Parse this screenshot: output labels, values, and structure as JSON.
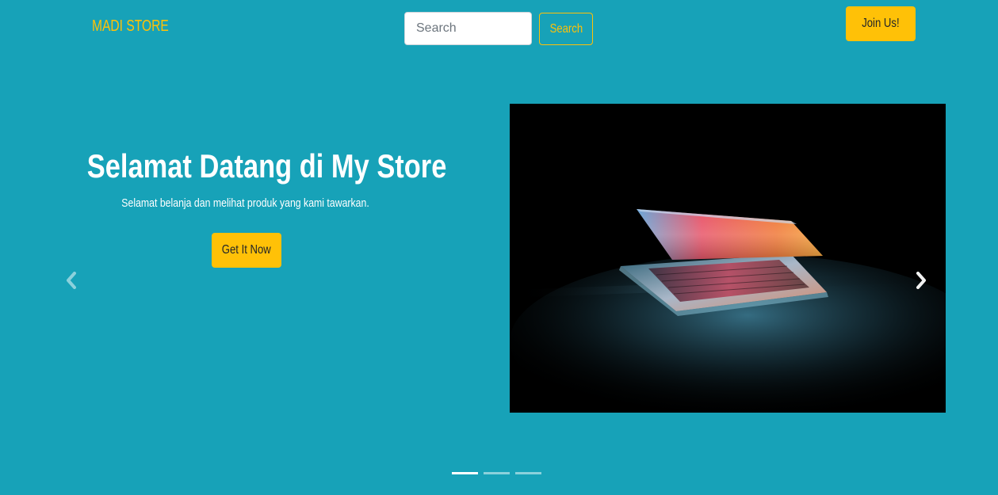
{
  "navbar": {
    "brand": "MADI STORE",
    "search_placeholder": "Search",
    "search_button": "Search",
    "join_button": "Join Us!"
  },
  "hero": {
    "title": "Selamat Datang di My Store",
    "subtitle": "Selamat belanja dan melihat produk yang kami tawarkan.",
    "cta_button": "Get It Now"
  },
  "carousel": {
    "slide_count": 3,
    "active_index": 0,
    "prev_icon": "chevron-left-icon",
    "next_icon": "chevron-right-icon"
  },
  "colors": {
    "background": "#17a2b8",
    "accent": "#ffc107",
    "text": "#ffffff"
  }
}
